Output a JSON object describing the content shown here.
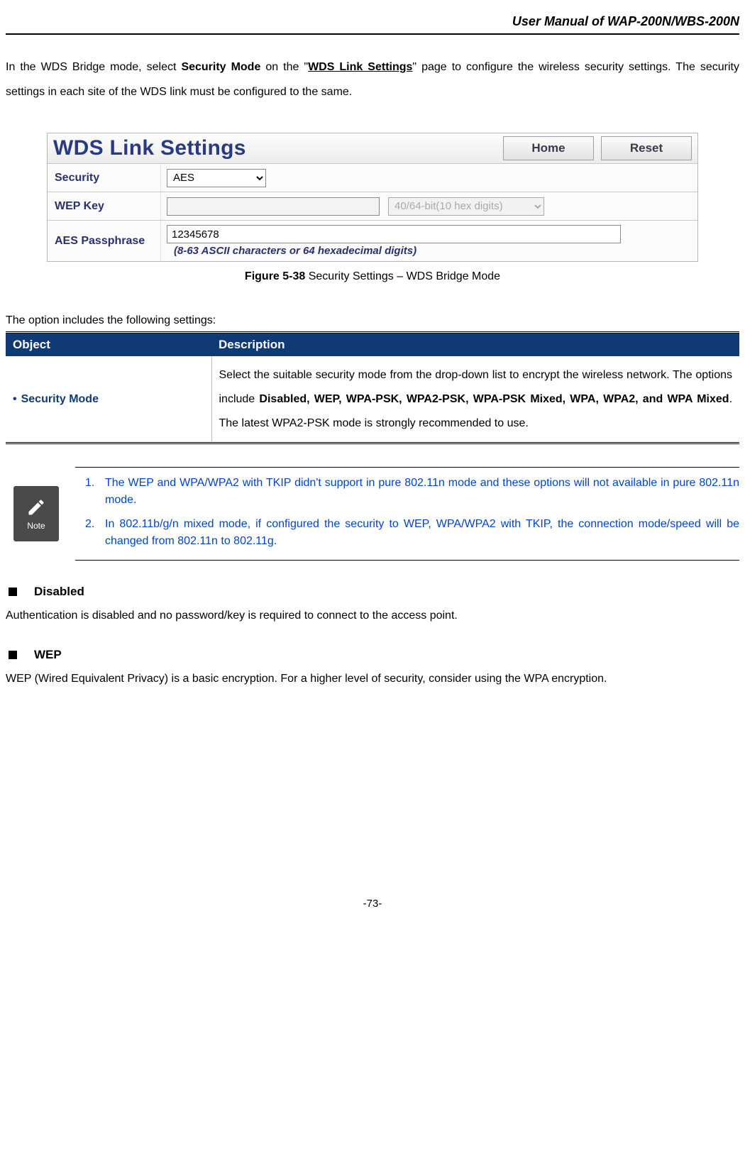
{
  "header": {
    "title": "User Manual of WAP-200N/WBS-200N"
  },
  "intro": {
    "pre": "In the WDS Bridge mode, select ",
    "b1": "Security Mode",
    "mid1": " on the \"",
    "b2": "WDS Link Settings",
    "post": "\" page to configure the wireless security settings. The security settings in each site of the WDS link must be configured to the same."
  },
  "panel": {
    "title": "WDS Link Settings",
    "btn_home": "Home",
    "btn_reset": "Reset",
    "rows": {
      "security": {
        "label": "Security",
        "value": "AES"
      },
      "wep": {
        "label": "WEP Key",
        "placeholder": "",
        "select": "40/64-bit(10 hex digits)"
      },
      "aes": {
        "label": "AES Passphrase",
        "value": "12345678",
        "hint": "(8-63 ASCII characters or 64 hexadecimal digits)"
      }
    }
  },
  "figure_caption": {
    "bold": "Figure 5-38",
    "rest": " Security Settings – WDS Bridge Mode"
  },
  "table_intro": "The option includes the following settings:",
  "table": {
    "head_obj": "Object",
    "head_desc": "Description",
    "row1": {
      "object": "Security Mode",
      "desc_pre": "Select the suitable security mode from the drop-down list to encrypt the wireless network. The options include ",
      "desc_bold": "Disabled, WEP, WPA-PSK, WPA2-PSK, WPA-PSK Mixed, WPA, WPA2, and WPA Mixed",
      "desc_post": ". The latest WPA2-PSK mode is strongly recommended to use."
    }
  },
  "note": {
    "label": "Note",
    "items": [
      {
        "n": "1.",
        "t": "The WEP and WPA/WPA2 with TKIP didn't support in pure 802.11n mode and these options will not available in pure 802.11n mode."
      },
      {
        "n": "2.",
        "t": "In 802.11b/g/n mixed mode, if configured the security to WEP, WPA/WPA2 with TKIP, the connection mode/speed will be changed from 802.11n to 802.11g."
      }
    ]
  },
  "sections": {
    "disabled": {
      "title": "Disabled",
      "body": "Authentication is disabled and no password/key is required to connect to the access point."
    },
    "wep": {
      "title": "WEP",
      "body": "WEP (Wired Equivalent Privacy) is a basic encryption. For a higher level of security, consider using the WPA encryption."
    }
  },
  "footer": "-73-"
}
